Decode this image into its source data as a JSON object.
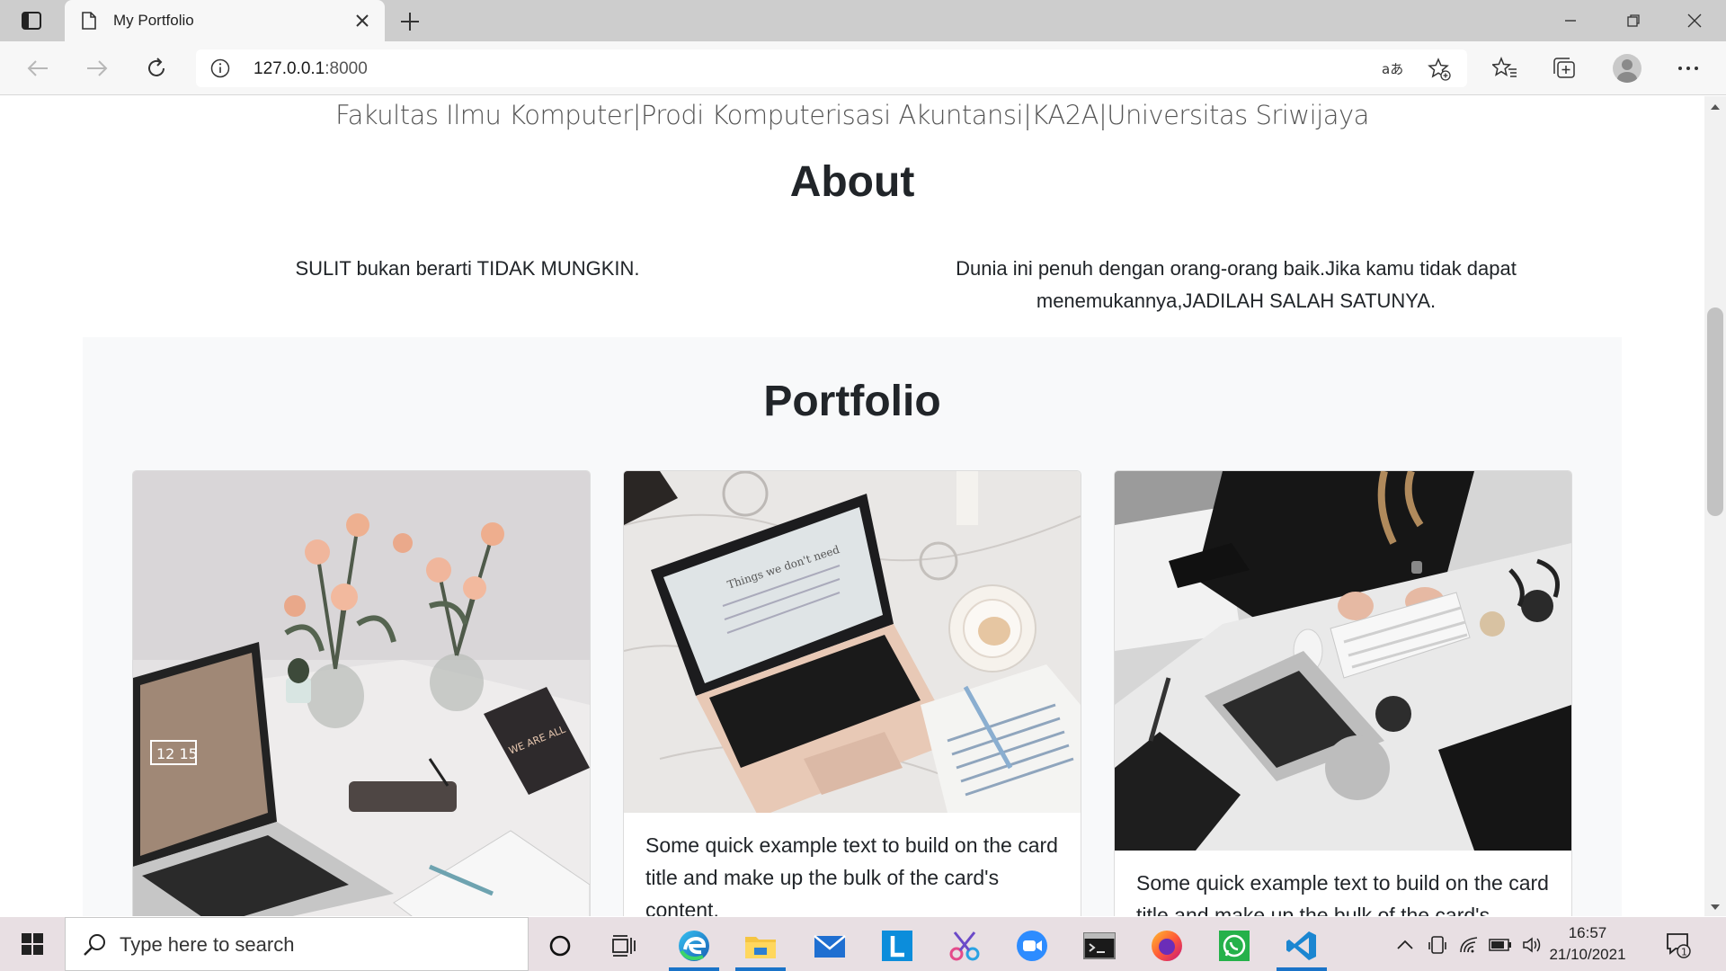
{
  "browser": {
    "tab_title": "My Portfolio",
    "url_host": "127.0.0.1",
    "url_port": ":8000"
  },
  "page": {
    "subtitle": "Fakultas Ilmu Komputer|Prodi Komputerisasi Akuntansi|KA2A|Universitas Sriwijaya",
    "about_title": "About",
    "about_left": "SULIT bukan berarti TIDAK MUNGKIN.",
    "about_right": "Dunia ini penuh dengan orang-orang baik.Jika kamu tidak dapat menemukannya,JADILAH SALAH SATUNYA.",
    "portfolio_title": "Portfolio",
    "cards": [
      {
        "text": ""
      },
      {
        "text": "Some quick example text to build on the card title and make up the bulk of the card's content."
      },
      {
        "text": "Some quick example text to build on the card title and make up the bulk of the card's content."
      }
    ]
  },
  "taskbar": {
    "search_placeholder": "Type here to search",
    "time": "16:57",
    "date": "21/10/2021",
    "notification_count": "1"
  },
  "colors": {
    "tabbar": "#cdcdcd",
    "taskbar": "#e8dfe3",
    "section_bg": "#f8f9fa",
    "accent": "#1a73c8"
  }
}
